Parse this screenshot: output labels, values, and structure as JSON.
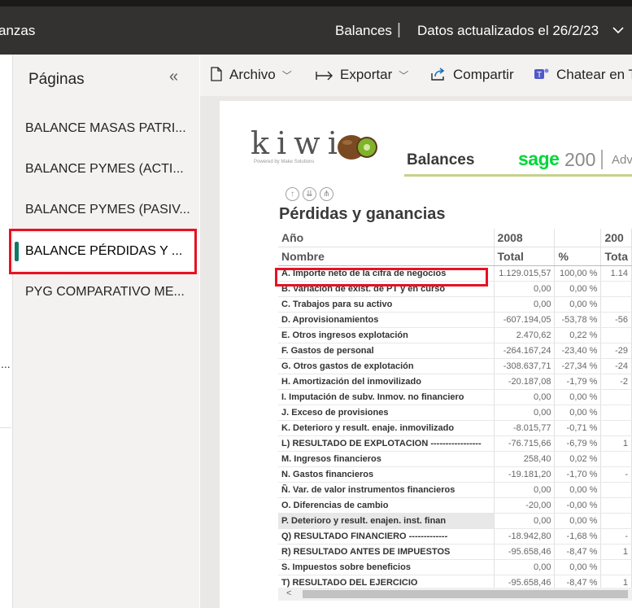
{
  "titlebar": {
    "app_name": "anzas",
    "report_name": "Balances",
    "separator": "|",
    "updated": "Datos actualizados el 26/2/23"
  },
  "pages_panel": {
    "title": "Páginas",
    "collapse_glyph": "«",
    "items": [
      {
        "label": "BALANCE MASAS PATRI..."
      },
      {
        "label": "BALANCE PYMES (ACTI..."
      },
      {
        "label": "BALANCE PYMES (PASIV..."
      },
      {
        "label": "BALANCE PÉRDIDAS Y ..."
      },
      {
        "label": "PYG COMPARATIVO ME..."
      }
    ],
    "active_index": 3
  },
  "left_strip": {
    "dots": "..."
  },
  "toolbar": {
    "archivo": "Archivo",
    "exportar": "Exportar",
    "compartir": "Compartir",
    "chatear": "Chatear en T"
  },
  "report": {
    "logo_text": "kiwi",
    "logo_sub": "Powered by Make Solutions",
    "header": "Balances",
    "sage": "sage",
    "sage_version": "200",
    "sage_suffix": "Adv",
    "section_title": "Pérdidas y ganancias",
    "accent_color": "#117865",
    "highlight_color": "#e81123",
    "table": {
      "year_label": "Año",
      "name_label": "Nombre",
      "year_2008": "2008",
      "year_next": "200",
      "total_label": "Total",
      "pct_label": "%",
      "total_next": "Tota",
      "rows": [
        {
          "name": "A. Importe neto de la cifra de negocios",
          "total": "1.129.015,57",
          "pct": "100,00 %",
          "next": "1.14"
        },
        {
          "name": "B. Variacion de exist. de PT y en curso",
          "total": "0,00",
          "pct": "0,00 %",
          "next": ""
        },
        {
          "name": "C. Trabajos para su activo",
          "total": "0,00",
          "pct": "0,00 %",
          "next": ""
        },
        {
          "name": "D. Aprovisionamientos",
          "total": "-607.194,05",
          "pct": "-53,78 %",
          "next": "-56"
        },
        {
          "name": "E. Otros ingresos explotación",
          "total": "2.470,62",
          "pct": "0,22 %",
          "next": ""
        },
        {
          "name": "F. Gastos de personal",
          "total": "-264.167,24",
          "pct": "-23,40 %",
          "next": "-29"
        },
        {
          "name": "G. Otros gastos de explotación",
          "total": "-308.637,71",
          "pct": "-27,34 %",
          "next": "-24"
        },
        {
          "name": "H. Amortización del inmovilizado",
          "total": "-20.187,08",
          "pct": "-1,79 %",
          "next": "-2"
        },
        {
          "name": "I. Imputación de subv. Inmov. no financiero",
          "total": "0,00",
          "pct": "0,00 %",
          "next": ""
        },
        {
          "name": "J. Exceso de provisiones",
          "total": "0,00",
          "pct": "0,00 %",
          "next": ""
        },
        {
          "name": "K. Deterioro y result. enaje. inmovilizado",
          "total": "-8.015,77",
          "pct": "-0,71 %",
          "next": ""
        },
        {
          "name": "L) RESULTADO DE EXPLOTACION -----------------",
          "total": "-76.715,66",
          "pct": "-6,79 %",
          "next": "1"
        },
        {
          "name": "M. Ingresos financieros",
          "total": "258,40",
          "pct": "0,02 %",
          "next": ""
        },
        {
          "name": "N. Gastos financieros",
          "total": "-19.181,20",
          "pct": "-1,70 %",
          "next": "-"
        },
        {
          "name": "Ñ. Var. de valor instrumentos financieros",
          "total": "0,00",
          "pct": "0,00 %",
          "next": ""
        },
        {
          "name": "O. Diferencias de cambio",
          "total": "-20,00",
          "pct": "-0,00 %",
          "next": ""
        },
        {
          "name": "P. Deterioro y result. enajen. inst. finan",
          "total": "0,00",
          "pct": "0,00 %",
          "next": ""
        },
        {
          "name": "Q) RESULTADO FINANCIERO -------------",
          "total": "-18.942,80",
          "pct": "-1,68 %",
          "next": "-"
        },
        {
          "name": "R) RESULTADO ANTES DE IMPUESTOS",
          "total": "-95.658,46",
          "pct": "-8,47 %",
          "next": "1"
        },
        {
          "name": "S. Impuestos sobre beneficios",
          "total": "0,00",
          "pct": "0,00 %",
          "next": ""
        },
        {
          "name": "T) RESULTADO DEL EJERCICIO",
          "total": "-95.658,46",
          "pct": "-8,47 %",
          "next": "1"
        }
      ]
    },
    "scroll_left": "<"
  }
}
